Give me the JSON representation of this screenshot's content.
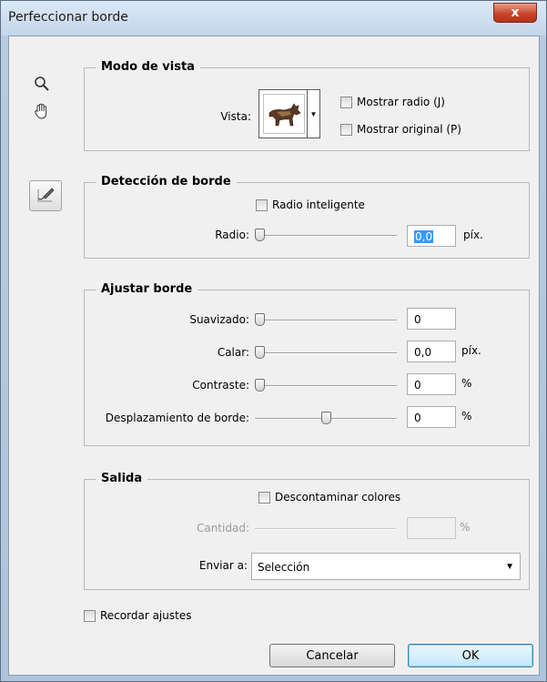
{
  "window": {
    "title": "Perfeccionar borde",
    "close_label": "x"
  },
  "tools": [
    {
      "name": "zoom-icon"
    },
    {
      "name": "hand-icon"
    },
    {
      "name": "refine-radius-brush-icon"
    }
  ],
  "view_mode": {
    "title": "Modo de vista",
    "view_label": "Vista:",
    "show_radius": {
      "label": "Mostrar radio (J)",
      "checked": false
    },
    "show_original": {
      "label": "Mostrar original (P)",
      "checked": false
    }
  },
  "edge_detection": {
    "title": "Detección de borde",
    "smart_radius": {
      "label": "Radio inteligente",
      "checked": false
    },
    "radius_label": "Radio:",
    "radius_value": "0,0",
    "radius_unit": "píx.",
    "radius_slider_fraction": 0
  },
  "adjust_edge": {
    "title": "Ajustar borde",
    "rows": [
      {
        "label": "Suavizado:",
        "value": "0",
        "unit": "",
        "slider_fraction": 0
      },
      {
        "label": "Calar:",
        "value": "0,0",
        "unit": "píx.",
        "slider_fraction": 0
      },
      {
        "label": "Contraste:",
        "value": "0",
        "unit": "%",
        "slider_fraction": 0
      },
      {
        "label": "Desplazamiento de borde:",
        "value": "0",
        "unit": "%",
        "slider_fraction": 0.5
      }
    ]
  },
  "output": {
    "title": "Salida",
    "decontaminate": {
      "label": "Descontaminar colores",
      "checked": false
    },
    "amount_label": "Cantidad:",
    "amount_value": "",
    "amount_unit": "%",
    "send_to_label": "Enviar a:",
    "send_to_value": "Selección"
  },
  "remember": {
    "label": "Recordar ajustes",
    "checked": false
  },
  "buttons": {
    "cancel": "Cancelar",
    "ok": "OK"
  },
  "colors": {
    "accent": "#3399ff",
    "close": "#c8452a"
  }
}
